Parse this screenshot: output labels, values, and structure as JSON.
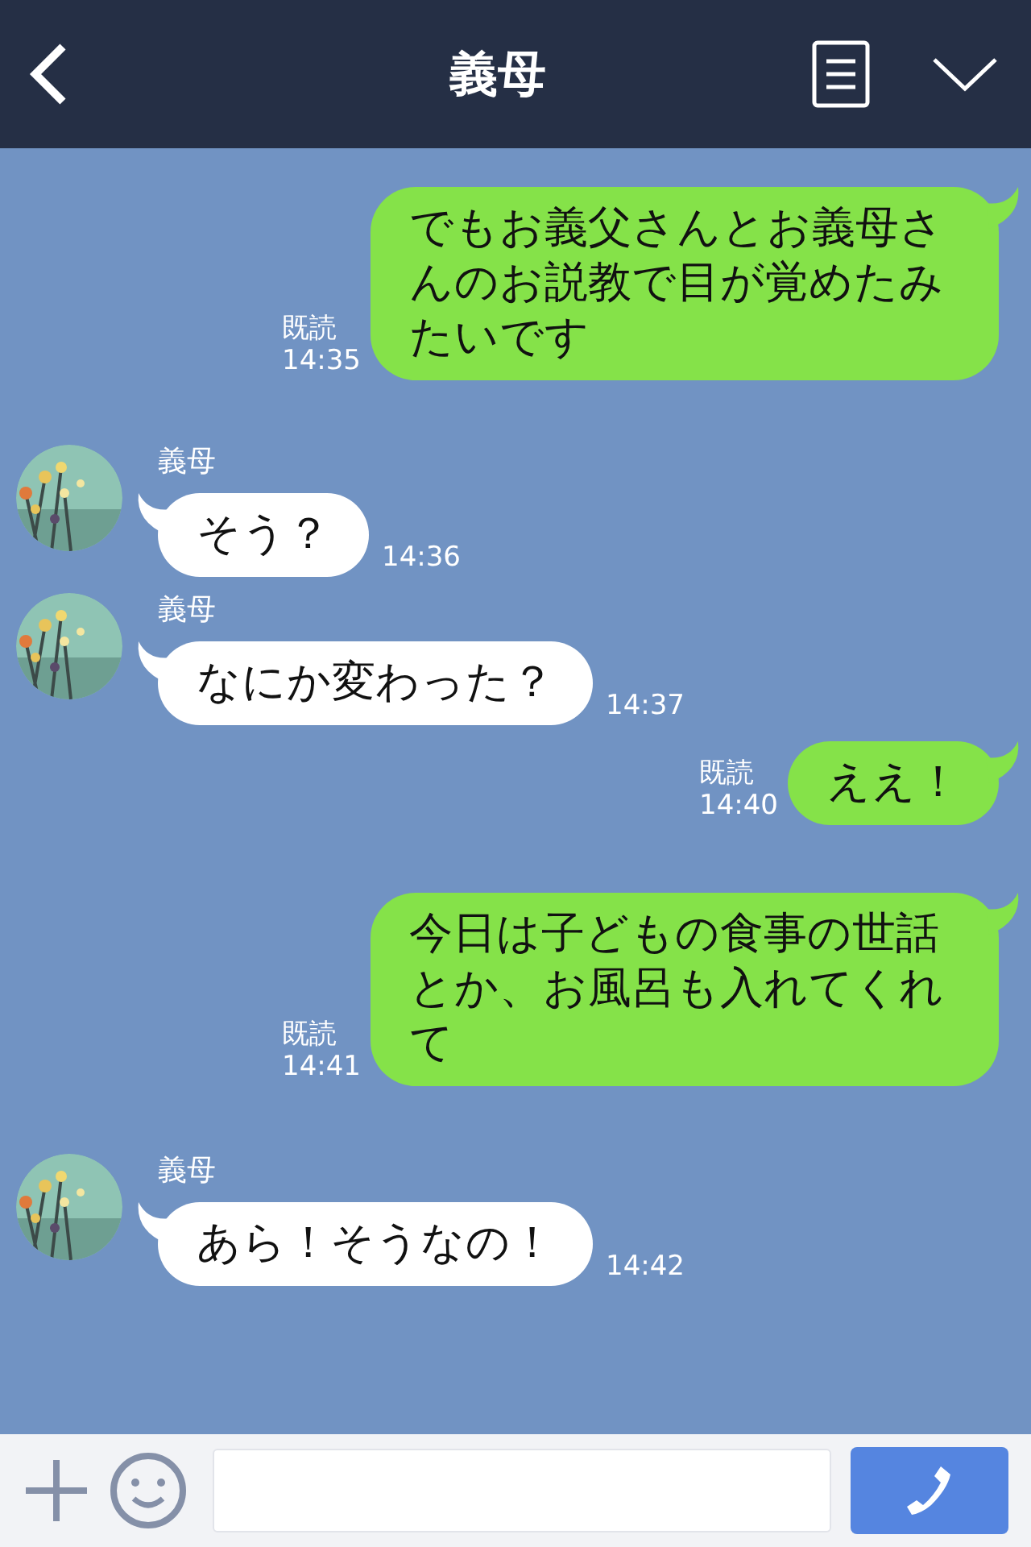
{
  "header": {
    "title": "義母"
  },
  "messages": [
    {
      "kind": "sent",
      "text": "でもお義父さんとお義母さんのお説教で目が覚めたみたいです",
      "read": "既読",
      "time": "14:35"
    },
    {
      "kind": "received",
      "sender": "義母",
      "text": "そう？",
      "time": "14:36"
    },
    {
      "kind": "received",
      "sender": "義母",
      "text": "なにか変わった？",
      "time": "14:37"
    },
    {
      "kind": "sent",
      "text": "ええ！",
      "read": "既読",
      "time": "14:40"
    },
    {
      "kind": "sent",
      "text": "今日は子どもの食事の世話とか、お風呂も入れてくれて",
      "read": "既読",
      "time": "14:41"
    },
    {
      "kind": "received",
      "sender": "義母",
      "text": "あら！そうなの！",
      "time": "14:42"
    }
  ]
}
